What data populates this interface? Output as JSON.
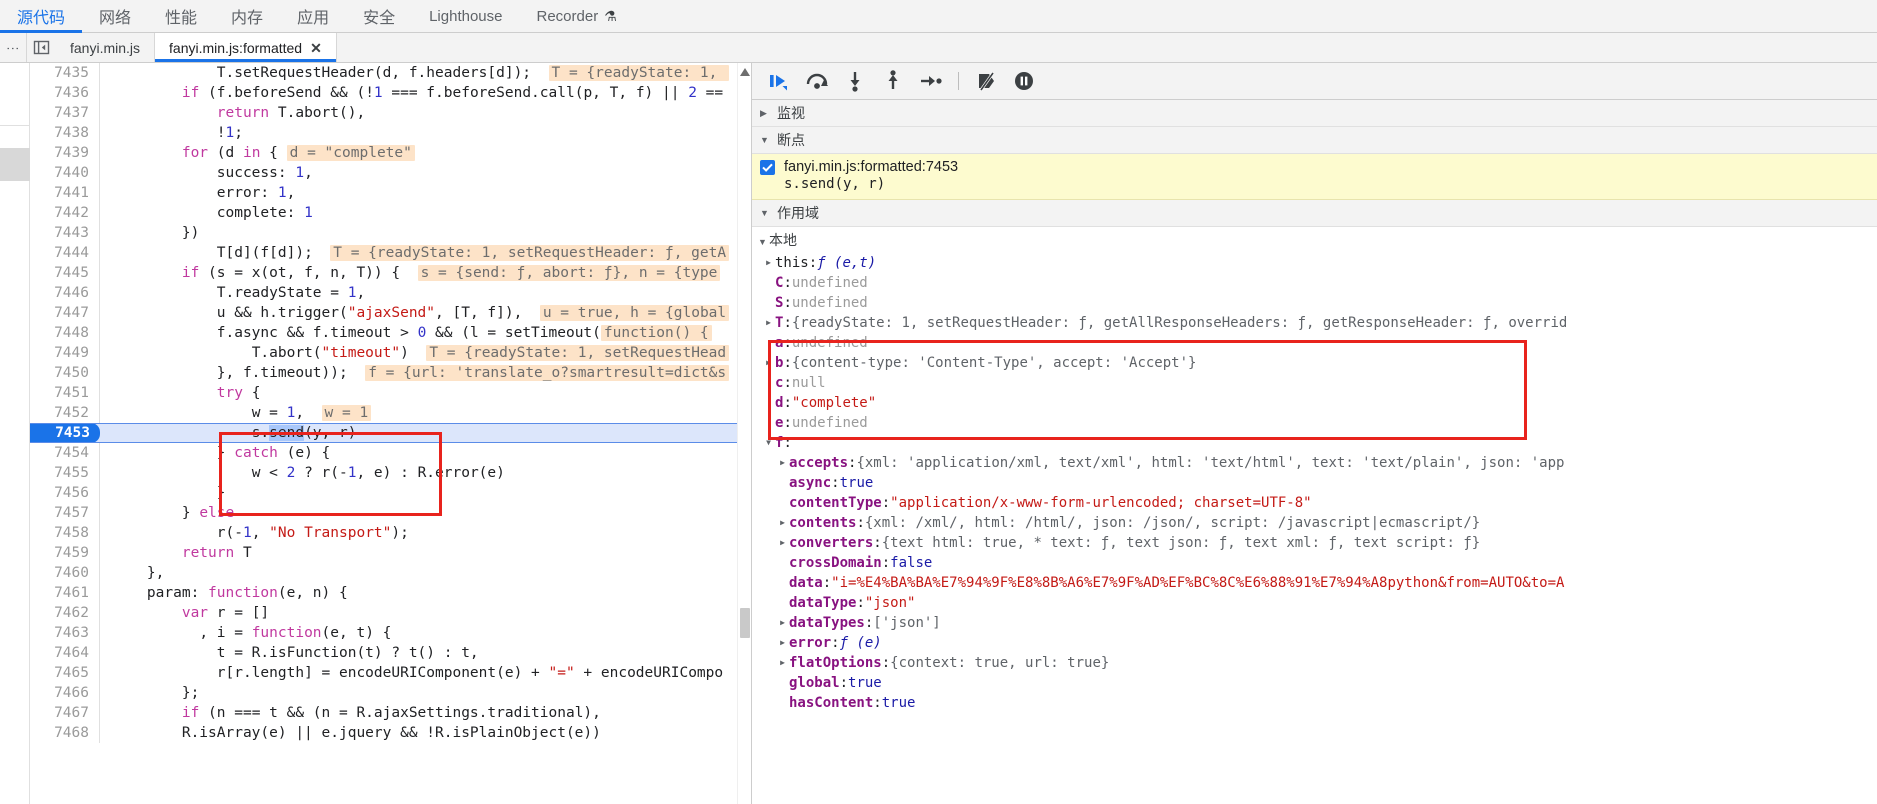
{
  "panel_tabs": [
    {
      "label": "源代码",
      "selected": true,
      "latin": false
    },
    {
      "label": "网络",
      "selected": false,
      "latin": false
    },
    {
      "label": "性能",
      "selected": false,
      "latin": false
    },
    {
      "label": "内存",
      "selected": false,
      "latin": false
    },
    {
      "label": "应用",
      "selected": false,
      "latin": false
    },
    {
      "label": "安全",
      "selected": false,
      "latin": false
    },
    {
      "label": "Lighthouse",
      "selected": false,
      "latin": true
    },
    {
      "label": "Recorder",
      "selected": false,
      "latin": true,
      "icon": "flask-icon"
    }
  ],
  "file_tabs": [
    {
      "label": "fanyi.min.js",
      "active": false,
      "closable": false
    },
    {
      "label": "fanyi.min.js:formatted",
      "active": true,
      "closable": true,
      "close_label": "✕"
    }
  ],
  "editor": {
    "first_line": 7435,
    "execution_line": 7453,
    "lines": [
      {
        "n": 7435,
        "indent": 12,
        "tokens": [
          {
            "t": "code",
            "v": "T.setRequestHeader(d, f.headers[d]);"
          },
          {
            "t": "gap",
            "v": "  "
          },
          {
            "t": "hint",
            "v": "T = {readyState: 1, "
          }
        ]
      },
      {
        "n": 7436,
        "indent": 8,
        "tokens": [
          {
            "t": "kw",
            "v": "if"
          },
          {
            "t": "code",
            "v": " (f.beforeSend && ("
          },
          {
            "t": "op",
            "v": "!"
          },
          {
            "t": "num",
            "v": "1"
          },
          {
            "t": "code",
            "v": " === f.beforeSend.call(p, T, f) || "
          },
          {
            "t": "num",
            "v": "2"
          },
          {
            "t": "code",
            "v": " =="
          }
        ]
      },
      {
        "n": 7437,
        "indent": 12,
        "tokens": [
          {
            "t": "kw",
            "v": "return"
          },
          {
            "t": "code",
            "v": " T.abort(),"
          }
        ]
      },
      {
        "n": 7438,
        "indent": 12,
        "tokens": [
          {
            "t": "code",
            "v": "!"
          },
          {
            "t": "num",
            "v": "1"
          },
          {
            "t": "code",
            "v": ";"
          }
        ]
      },
      {
        "n": 7439,
        "indent": 8,
        "tokens": [
          {
            "t": "kw",
            "v": "for"
          },
          {
            "t": "code",
            "v": " (d "
          },
          {
            "t": "kw",
            "v": "in"
          },
          {
            "t": "code",
            "v": " { "
          },
          {
            "t": "hint",
            "v": "d = \"complete\""
          }
        ]
      },
      {
        "n": 7440,
        "indent": 12,
        "tokens": [
          {
            "t": "code",
            "v": "success: "
          },
          {
            "t": "num",
            "v": "1"
          },
          {
            "t": "code",
            "v": ","
          }
        ]
      },
      {
        "n": 7441,
        "indent": 12,
        "tokens": [
          {
            "t": "code",
            "v": "error: "
          },
          {
            "t": "num",
            "v": "1"
          },
          {
            "t": "code",
            "v": ","
          }
        ]
      },
      {
        "n": 7442,
        "indent": 12,
        "tokens": [
          {
            "t": "code",
            "v": "complete: "
          },
          {
            "t": "num",
            "v": "1"
          }
        ]
      },
      {
        "n": 7443,
        "indent": 8,
        "tokens": [
          {
            "t": "code",
            "v": "})"
          }
        ]
      },
      {
        "n": 7444,
        "indent": 12,
        "tokens": [
          {
            "t": "code",
            "v": "T[d](f[d]);"
          },
          {
            "t": "gap",
            "v": "  "
          },
          {
            "t": "hint",
            "v": "T = {readyState: 1, setRequestHeader: ƒ, getA"
          }
        ]
      },
      {
        "n": 7445,
        "indent": 8,
        "tokens": [
          {
            "t": "kw",
            "v": "if"
          },
          {
            "t": "code",
            "v": " (s = x(ot, f, n, T)) {"
          },
          {
            "t": "gap",
            "v": "  "
          },
          {
            "t": "hint",
            "v": "s = {send: ƒ, abort: ƒ}, n = {type"
          }
        ]
      },
      {
        "n": 7446,
        "indent": 12,
        "tokens": [
          {
            "t": "code",
            "v": "T.readyState = "
          },
          {
            "t": "num",
            "v": "1"
          },
          {
            "t": "code",
            "v": ","
          }
        ]
      },
      {
        "n": 7447,
        "indent": 12,
        "tokens": [
          {
            "t": "code",
            "v": "u && h.trigger("
          },
          {
            "t": "str",
            "v": "\"ajaxSend\""
          },
          {
            "t": "code",
            "v": ", [T, f]),"
          },
          {
            "t": "gap",
            "v": "  "
          },
          {
            "t": "hint",
            "v": "u = true, h = {global"
          }
        ]
      },
      {
        "n": 7448,
        "indent": 12,
        "tokens": [
          {
            "t": "code",
            "v": "f.async && f.timeout > "
          },
          {
            "t": "num",
            "v": "0"
          },
          {
            "t": "code",
            "v": " && (l = setTimeout("
          },
          {
            "t": "hint",
            "v": "function() {"
          }
        ]
      },
      {
        "n": 7449,
        "indent": 16,
        "tokens": [
          {
            "t": "code",
            "v": "T.abort("
          },
          {
            "t": "str",
            "v": "\"timeout\""
          },
          {
            "t": "code",
            "v": ")"
          },
          {
            "t": "gap",
            "v": "  "
          },
          {
            "t": "hint",
            "v": "T = {readyState: 1, setRequestHead"
          }
        ]
      },
      {
        "n": 7450,
        "indent": 12,
        "tokens": [
          {
            "t": "code",
            "v": "}, f.timeout));"
          },
          {
            "t": "gap",
            "v": "  "
          },
          {
            "t": "hint",
            "v": "f = {url: 'translate_o?smartresult=dict&s"
          }
        ]
      },
      {
        "n": 7451,
        "indent": 12,
        "tokens": [
          {
            "t": "kw",
            "v": "try"
          },
          {
            "t": "code",
            "v": " {"
          }
        ]
      },
      {
        "n": 7452,
        "indent": 16,
        "tokens": [
          {
            "t": "code",
            "v": "w = "
          },
          {
            "t": "num",
            "v": "1"
          },
          {
            "t": "code",
            "v": ","
          },
          {
            "t": "gap",
            "v": "  "
          },
          {
            "t": "hint",
            "v": "w = 1"
          }
        ]
      },
      {
        "n": 7453,
        "indent": 16,
        "tokens": [
          {
            "t": "code",
            "v": "s."
          },
          {
            "t": "selected",
            "v": "send"
          },
          {
            "t": "code",
            "v": "(y, r)"
          }
        ]
      },
      {
        "n": 7454,
        "indent": 12,
        "tokens": [
          {
            "t": "code",
            "v": "} "
          },
          {
            "t": "kw",
            "v": "catch"
          },
          {
            "t": "code",
            "v": " (e) {"
          }
        ]
      },
      {
        "n": 7455,
        "indent": 16,
        "tokens": [
          {
            "t": "code",
            "v": "w < "
          },
          {
            "t": "num",
            "v": "2"
          },
          {
            "t": "code",
            "v": " ? r(-"
          },
          {
            "t": "num",
            "v": "1"
          },
          {
            "t": "code",
            "v": ", e) : R.error(e)"
          }
        ]
      },
      {
        "n": 7456,
        "indent": 12,
        "tokens": [
          {
            "t": "code",
            "v": "}"
          }
        ]
      },
      {
        "n": 7457,
        "indent": 8,
        "tokens": [
          {
            "t": "code",
            "v": "} "
          },
          {
            "t": "kw",
            "v": "else"
          }
        ]
      },
      {
        "n": 7458,
        "indent": 12,
        "tokens": [
          {
            "t": "code",
            "v": "r(-"
          },
          {
            "t": "num",
            "v": "1"
          },
          {
            "t": "code",
            "v": ", "
          },
          {
            "t": "str",
            "v": "\"No Transport\""
          },
          {
            "t": "code",
            "v": ");"
          }
        ]
      },
      {
        "n": 7459,
        "indent": 8,
        "tokens": [
          {
            "t": "kw",
            "v": "return"
          },
          {
            "t": "code",
            "v": " T"
          }
        ]
      },
      {
        "n": 7460,
        "indent": 4,
        "tokens": [
          {
            "t": "code",
            "v": "},"
          }
        ]
      },
      {
        "n": 7461,
        "indent": 4,
        "tokens": [
          {
            "t": "code",
            "v": "param: "
          },
          {
            "t": "kw",
            "v": "function"
          },
          {
            "t": "code",
            "v": "(e, n) {"
          }
        ]
      },
      {
        "n": 7462,
        "indent": 8,
        "tokens": [
          {
            "t": "kw",
            "v": "var"
          },
          {
            "t": "code",
            "v": " r = []"
          }
        ]
      },
      {
        "n": 7463,
        "indent": 10,
        "tokens": [
          {
            "t": "code",
            "v": ", i = "
          },
          {
            "t": "kw",
            "v": "function"
          },
          {
            "t": "code",
            "v": "(e, t) {"
          }
        ]
      },
      {
        "n": 7464,
        "indent": 12,
        "tokens": [
          {
            "t": "code",
            "v": "t = R.isFunction(t) ? t() : t,"
          }
        ]
      },
      {
        "n": 7465,
        "indent": 12,
        "tokens": [
          {
            "t": "code",
            "v": "r[r.length] = encodeURIComponent(e) + "
          },
          {
            "t": "str",
            "v": "\"=\""
          },
          {
            "t": "code",
            "v": " + encodeURICompo"
          }
        ]
      },
      {
        "n": 7466,
        "indent": 8,
        "tokens": [
          {
            "t": "code",
            "v": "};"
          }
        ]
      },
      {
        "n": 7467,
        "indent": 8,
        "tokens": [
          {
            "t": "kw",
            "v": "if"
          },
          {
            "t": "code",
            "v": " (n === t && (n = R.ajaxSettings.traditional),"
          }
        ]
      },
      {
        "n": 7468,
        "indent": 8,
        "tokens": [
          {
            "t": "code",
            "v": "R.isArray(e) || e.jquery && !R.isPlainObject(e))"
          }
        ]
      }
    ]
  },
  "debug_toolbar": {
    "buttons": [
      {
        "name": "resume-script-execution",
        "title": "继续"
      },
      {
        "name": "step-over-next-function-call",
        "title": "跳过"
      },
      {
        "name": "step-into-next-function-call",
        "title": "步入"
      },
      {
        "name": "step-out-of-current-function",
        "title": "步出"
      },
      {
        "name": "step",
        "title": "步进"
      },
      {
        "name": "deactivate-breakpoints",
        "title": "停用断点"
      },
      {
        "name": "pause-on-exceptions",
        "title": "异常时暂停"
      }
    ]
  },
  "sidebar": {
    "watch": {
      "label": "监视",
      "expanded": false
    },
    "breakpoints": {
      "label": "断点",
      "expanded": true,
      "items": [
        {
          "checked": true,
          "location": "fanyi.min.js:formatted:7453",
          "code": "s.send(y, r)"
        }
      ]
    },
    "scope": {
      "label": "作用域",
      "expanded": true,
      "groups": [
        {
          "label": "本地",
          "expanded": true,
          "vars": [
            {
              "arrow": true,
              "key": "this",
              "type": "fn",
              "value": "ƒ (e,t)"
            },
            {
              "arrow": false,
              "key": "C",
              "type": "undef",
              "value": "undefined"
            },
            {
              "arrow": false,
              "key": "S",
              "type": "undef",
              "value": "undefined"
            },
            {
              "arrow": true,
              "key": "T",
              "type": "obj",
              "value": "{readyState: 1, setRequestHeader: ƒ, getAllResponseHeaders: ƒ, getResponseHeader: ƒ, overrid"
            },
            {
              "arrow": false,
              "key": "a",
              "type": "undef",
              "value": "undefined"
            },
            {
              "arrow": true,
              "key": "b",
              "type": "obj",
              "value": "{content-type: 'Content-Type', accept: 'Accept'}"
            },
            {
              "arrow": false,
              "key": "c",
              "type": "null",
              "value": "null"
            },
            {
              "arrow": false,
              "key": "d",
              "type": "str",
              "value": "\"complete\""
            },
            {
              "arrow": false,
              "key": "e",
              "type": "undef",
              "value": "undefined"
            },
            {
              "arrow": true,
              "key": "f",
              "type": "expand",
              "value": ""
            },
            {
              "arrow": true,
              "key": "accepts",
              "indent": 1,
              "type": "obj",
              "value": "{xml: 'application/xml, text/xml', html: 'text/html', text: 'text/plain', json: 'app"
            },
            {
              "arrow": false,
              "key": "async",
              "indent": 1,
              "type": "bool",
              "value": "true"
            },
            {
              "arrow": false,
              "key": "contentType",
              "indent": 1,
              "type": "str",
              "value": "\"application/x-www-form-urlencoded; charset=UTF-8\""
            },
            {
              "arrow": true,
              "key": "contents",
              "indent": 1,
              "type": "obj",
              "value": "{xml: /xml/, html: /html/, json: /json/, script: /javascript|ecmascript/}"
            },
            {
              "arrow": true,
              "key": "converters",
              "indent": 1,
              "type": "obj",
              "value": "{text html: true, * text: ƒ, text json: ƒ, text xml: ƒ, text script: ƒ}"
            },
            {
              "arrow": false,
              "key": "crossDomain",
              "indent": 1,
              "type": "bool",
              "value": "false"
            },
            {
              "arrow": false,
              "key": "data",
              "indent": 1,
              "type": "str",
              "value": "\"i=%E4%BA%BA%E7%94%9F%E8%8B%A6%E7%9F%AD%EF%BC%8C%E6%88%91%E7%94%A8python&from=AUTO&to=A"
            },
            {
              "arrow": false,
              "key": "dataType",
              "indent": 1,
              "type": "str",
              "value": "\"json\""
            },
            {
              "arrow": true,
              "key": "dataTypes",
              "indent": 1,
              "type": "obj",
              "value": "['json']"
            },
            {
              "arrow": true,
              "key": "error",
              "indent": 1,
              "type": "fn",
              "value": "ƒ (e)"
            },
            {
              "arrow": true,
              "key": "flatOptions",
              "indent": 1,
              "type": "obj",
              "value": "{context: true, url: true}"
            },
            {
              "arrow": false,
              "key": "global",
              "indent": 1,
              "type": "bool",
              "value": "true"
            },
            {
              "arrow": false,
              "key": "hasContent",
              "indent": 1,
              "type": "bool",
              "value": "true"
            }
          ]
        }
      ]
    }
  },
  "annotations": {
    "editor_box_label": "red-highlight-box",
    "sidebar_box_label": "red-highlight-box"
  },
  "colors": {
    "accent": "#1a73e8",
    "highlight_red": "#e8231d",
    "breakpoint_yellow": "#fdfbcf",
    "inline_hint": "#fde3c8",
    "exec_line": "#dce6fb"
  }
}
